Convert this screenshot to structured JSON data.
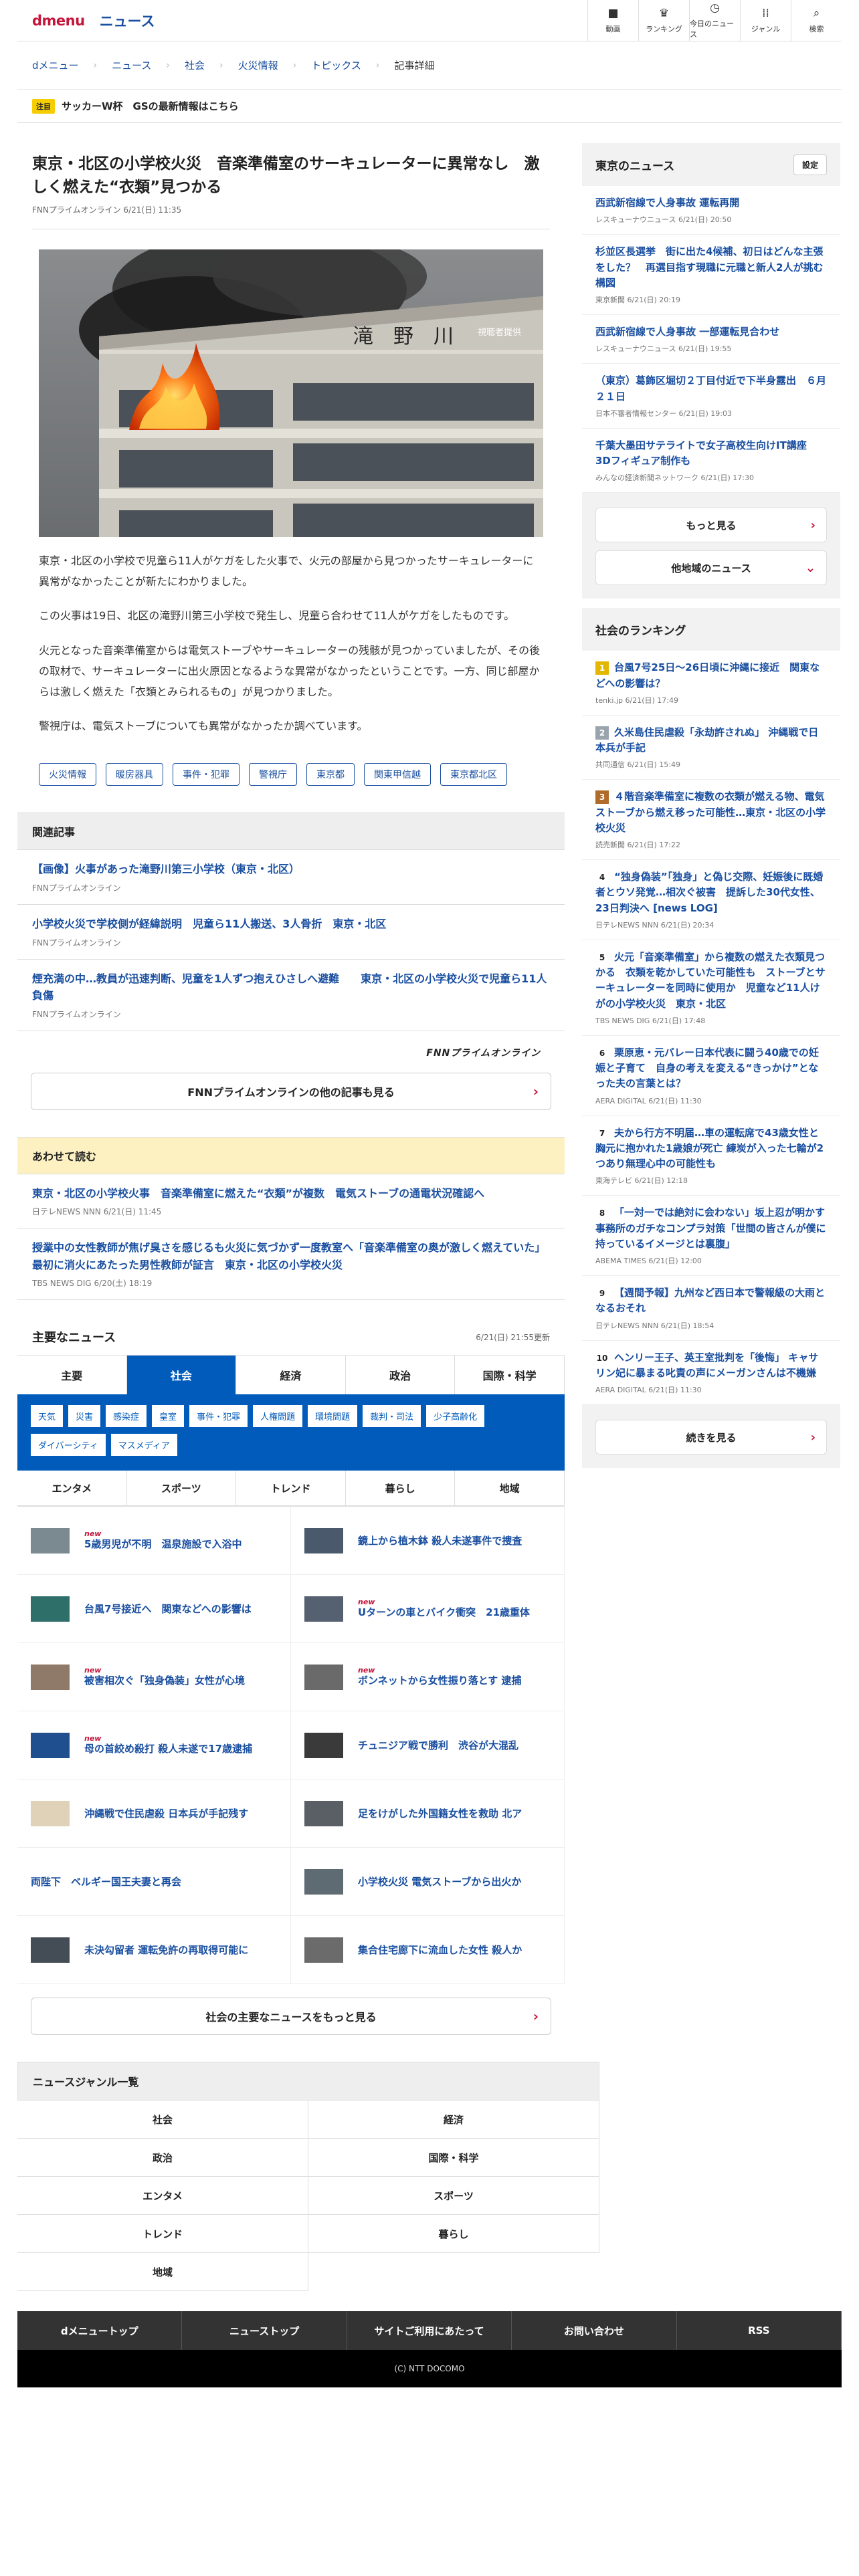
{
  "header": {
    "logo": "dmenu",
    "site": "ニュース",
    "nav": [
      {
        "label": "動画",
        "icon": "video-icon",
        "glyph": "■"
      },
      {
        "label": "ランキング",
        "icon": "crown-icon",
        "glyph": "♛"
      },
      {
        "label": "今日のニュース",
        "icon": "clock-icon",
        "glyph": "◷"
      },
      {
        "label": "ジャンル",
        "icon": "grid-icon",
        "glyph": "⁞⁞"
      },
      {
        "label": "検索",
        "icon": "search-icon",
        "glyph": "⌕"
      }
    ]
  },
  "breadcrumb": [
    "dメニュー",
    "ニュース",
    "社会",
    "火災情報",
    "トピックス",
    "記事詳細"
  ],
  "trend": {
    "tag": "注目",
    "text": "サッカーW杯　GSの最新情報はこちら"
  },
  "article": {
    "title": "東京・北区の小学校火災　音楽準備室のサーキュレーターに異常なし　激しく燃えた“衣類”見つかる",
    "meta": "FNNプライムオンライン 6/21(日) 11:35",
    "photo_caption": "視聴者提供",
    "building_sign": "滝　野　川",
    "paragraphs": [
      "東京・北区の小学校で児童ら11人がケガをした火事で、火元の部屋から見つかったサーキュレーターに異常がなかったことが新たにわかりました。",
      "この火事は19日、北区の滝野川第三小学校で発生し、児童ら合わせて11人がケガをしたものです。",
      "火元となった音楽準備室からは電気ストーブやサーキュレーターの残骸が見つかっていましたが、その後の取材で、サーキュレーターに出火原因となるような異常がなかったということです。一方、同じ部屋からは激しく燃えた「衣類とみられるもの」が見つかりました。",
      "警視庁は、電気ストーブについても異常がなかったか調べています。"
    ],
    "tags": [
      "火災情報",
      "暖房器具",
      "事件・犯罪",
      "警視庁",
      "東京都",
      "関東甲信越",
      "東京都北区"
    ]
  },
  "related": {
    "heading": "関連記事",
    "items": [
      {
        "title": "【画像】火事があった滝野川第三小学校（東京・北区）",
        "meta": "FNNプライムオンライン"
      },
      {
        "title": "小学校火災で学校側が経緯説明　児童ら11人搬送、3人骨折　東京・北区",
        "meta": "FNNプライムオンライン"
      },
      {
        "title": "煙充満の中…教員が迅速判断、児童を1人ずつ抱えひさしへ避難　　東京・北区の小学校火災で児童ら11人負傷",
        "meta": "FNNプライムオンライン"
      }
    ],
    "publisher_logo": "FNNプライムオンライン",
    "more_label": "FNNプライムオンラインの他の記事も見る"
  },
  "also_read": {
    "heading": "あわせて読む",
    "items": [
      {
        "title": "東京・北区の小学校火事　音楽準備室に燃えた“衣類”が複数　電気ストーブの通電状況確認へ",
        "meta": "日テレNEWS NNN 6/21(日) 11:45"
      },
      {
        "title": "授業中の女性教師が焦げ臭さを感じるも火災に気づかず一度教室へ「音楽準備室の奥が激しく燃えていた」最初に消火にあたった男性教師が証言　東京・北区の小学校火災",
        "meta": "TBS NEWS DIG 6/20(土) 18:19"
      }
    ]
  },
  "main_news": {
    "heading": "主要なニュース",
    "updated": "6/21(日) 21:55更新",
    "tabs": [
      "主要",
      "社会",
      "経済",
      "政治",
      "国際・科学"
    ],
    "active_tab": 1,
    "chips": [
      "天気",
      "災害",
      "感染症",
      "皇室",
      "事件・犯罪",
      "人権問題",
      "環境問題",
      "裁判・司法",
      "少子高齢化",
      "ダイバーシティ",
      "マスメディア"
    ],
    "tabs2": [
      "エンタメ",
      "スポーツ",
      "トレンド",
      "暮らし",
      "地域"
    ],
    "items": [
      {
        "title": "5歳男児が不明　温泉施設で入浴中",
        "new": true,
        "thumb": "#7a8a90"
      },
      {
        "title": "鏡上から植木鉢 殺人未遂事件で捜査",
        "new": false,
        "thumb": "#4a5a6c"
      },
      {
        "title": "台風7号接近へ　関東などへの影響は",
        "new": false,
        "thumb": "#2f6f6a"
      },
      {
        "title": "Uターンの車とバイク衝突　21歳重体",
        "new": true,
        "thumb": "#556070"
      },
      {
        "title": "被害相次ぐ「独身偽装」女性が心境",
        "new": true,
        "thumb": "#8f7a6a"
      },
      {
        "title": "ボンネットから女性振り落とす 逮捕",
        "new": true,
        "thumb": "#6a6a6a"
      },
      {
        "title": "母の首絞め殺打 殺人未遂で17歳逮捕",
        "new": true,
        "thumb": "#1f4f8f"
      },
      {
        "title": "チュニジア戦で勝利　渋谷が大混乱",
        "new": false,
        "thumb": "#3a3a3a"
      },
      {
        "title": "沖縄戦で住民虐殺 日本兵が手記残す",
        "new": false,
        "thumb": "#e0d2b8"
      },
      {
        "title": "足をけがした外国籍女性を救助 北ア",
        "new": false,
        "thumb": "#5a5f66"
      },
      {
        "title": "両陛下　ベルギー国王夫妻と再会",
        "new": false,
        "thumb": ""
      },
      {
        "title": "小学校火災 電気ストーブから出火か",
        "new": false,
        "thumb": "#5f6b72"
      },
      {
        "title": "未決勾留者 運転免許の再取得可能に",
        "new": false,
        "thumb": "#444c55"
      },
      {
        "title": "集合住宅廊下に流血した女性 殺人か",
        "new": false,
        "thumb": "#6b6b6b"
      }
    ],
    "more_label": "社会の主要なニュースをもっと見る"
  },
  "genres": {
    "heading": "ニュースジャンル一覧",
    "items": [
      "社会",
      "経済",
      "政治",
      "国際・科学",
      "エンタメ",
      "スポーツ",
      "トレンド",
      "暮らし",
      "地域"
    ]
  },
  "footer": {
    "nav": [
      "dメニュートップ",
      "ニューストップ",
      "サイトご利用にあたって",
      "お問い合わせ",
      "RSS"
    ],
    "copyright": "(C) NTT DOCOMO"
  },
  "side": {
    "local": {
      "heading": "東京のニュース",
      "settings": "設定",
      "items": [
        {
          "title": "西武新宿線で人身事故 運転再開",
          "meta": "レスキューナウニュース 6/21(日) 20:50"
        },
        {
          "title": "杉並区長選挙　街に出た4候補、初日はどんな主張をした？　再選目指す現職に元職と新人2人が挑む構図",
          "meta": "東京新聞 6/21(日) 20:19"
        },
        {
          "title": "西武新宿線で人身事故 一部運転見合わせ",
          "meta": "レスキューナウニュース 6/21(日) 19:55"
        },
        {
          "title": "（東京）葛飾区堀切２丁目付近で下半身露出　６月２１日",
          "meta": "日本不審者情報センター 6/21(日) 19:03"
        },
        {
          "title": "千葉大墨田サテライトで女子高校生向けIT講座　3Dフィギュア制作も",
          "meta": "みんなの経済新聞ネットワーク 6/21(日) 17:30"
        }
      ],
      "more_label": "もっと見る",
      "other_label": "他地域のニュース"
    },
    "ranking": {
      "heading": "社会のランキング",
      "items": [
        {
          "rank": "1",
          "title": "台風7号25日〜26日頃に沖縄に接近　関東などへの影響は？",
          "meta": "tenki.jp 6/21(日) 17:49",
          "color": "#e3b700"
        },
        {
          "rank": "2",
          "title": "久米島住民虐殺「永劫許されぬ」 沖縄戦で日本兵が手記",
          "meta": "共同通信 6/21(日) 15:49",
          "color": "#9aa4ad"
        },
        {
          "rank": "3",
          "title": "４階音楽準備室に複数の衣類が燃える物、電気ストーブから燃え移った可能性…東京・北区の小学校火災",
          "meta": "読売新聞 6/21(日) 17:22",
          "color": "#b06a2a"
        },
        {
          "rank": "4",
          "title": "“独身偽装”「独身」と偽じ交際、妊娠後に既婚者とウソ発覚…相次ぐ被害　提訴した30代女性、23日判決へ [news LOG]",
          "meta": "日テレNEWS NNN 6/21(日) 20:34",
          "color": "#888"
        },
        {
          "rank": "5",
          "title": "火元「音楽準備室」から複数の燃えた衣類見つかる　衣類を乾かしていた可能性も　ストーブとサーキュレーターを同時に使用か　児童など11人けがの小学校火災　東京・北区",
          "meta": "TBS NEWS DIG 6/21(日) 17:48",
          "color": "#888"
        },
        {
          "rank": "6",
          "title": "栗原恵・元バレー日本代表に闘う40歳での妊娠と子育て　自身の考えを変える“きっかけ”となった夫の言葉とは？",
          "meta": "AERA DIGITAL 6/21(日) 11:30",
          "color": "#888"
        },
        {
          "rank": "7",
          "title": "夫から行方不明届…車の運転席で43歳女性と胸元に抱かれた1歳娘が死亡 練炭が入った七輪が2つあり無理心中の可能性も",
          "meta": "東海テレビ 6/21(日) 12:18",
          "color": "#888"
        },
        {
          "rank": "8",
          "title": "「一対一では絶対に会わない」坂上忍が明かす事務所のガチなコンプラ対策「世間の皆さんが僕に持っているイメージとは裏腹」",
          "meta": "ABEMA TIMES 6/21(日) 12:00",
          "color": "#888"
        },
        {
          "rank": "9",
          "title": "【週間予報】九州など西日本で警報級の大雨となるおそれ",
          "meta": "日テレNEWS NNN 6/21(日) 18:54",
          "color": "#888"
        },
        {
          "rank": "10",
          "title": "ヘンリー王子、英王室批判を「後悔」 キャサリン妃に暴まる叱責の声にメーガンさんは不機嫌",
          "meta": "AERA DIGITAL 6/21(日) 11:30",
          "color": "#888"
        }
      ],
      "more_label": "続きを見る"
    }
  }
}
